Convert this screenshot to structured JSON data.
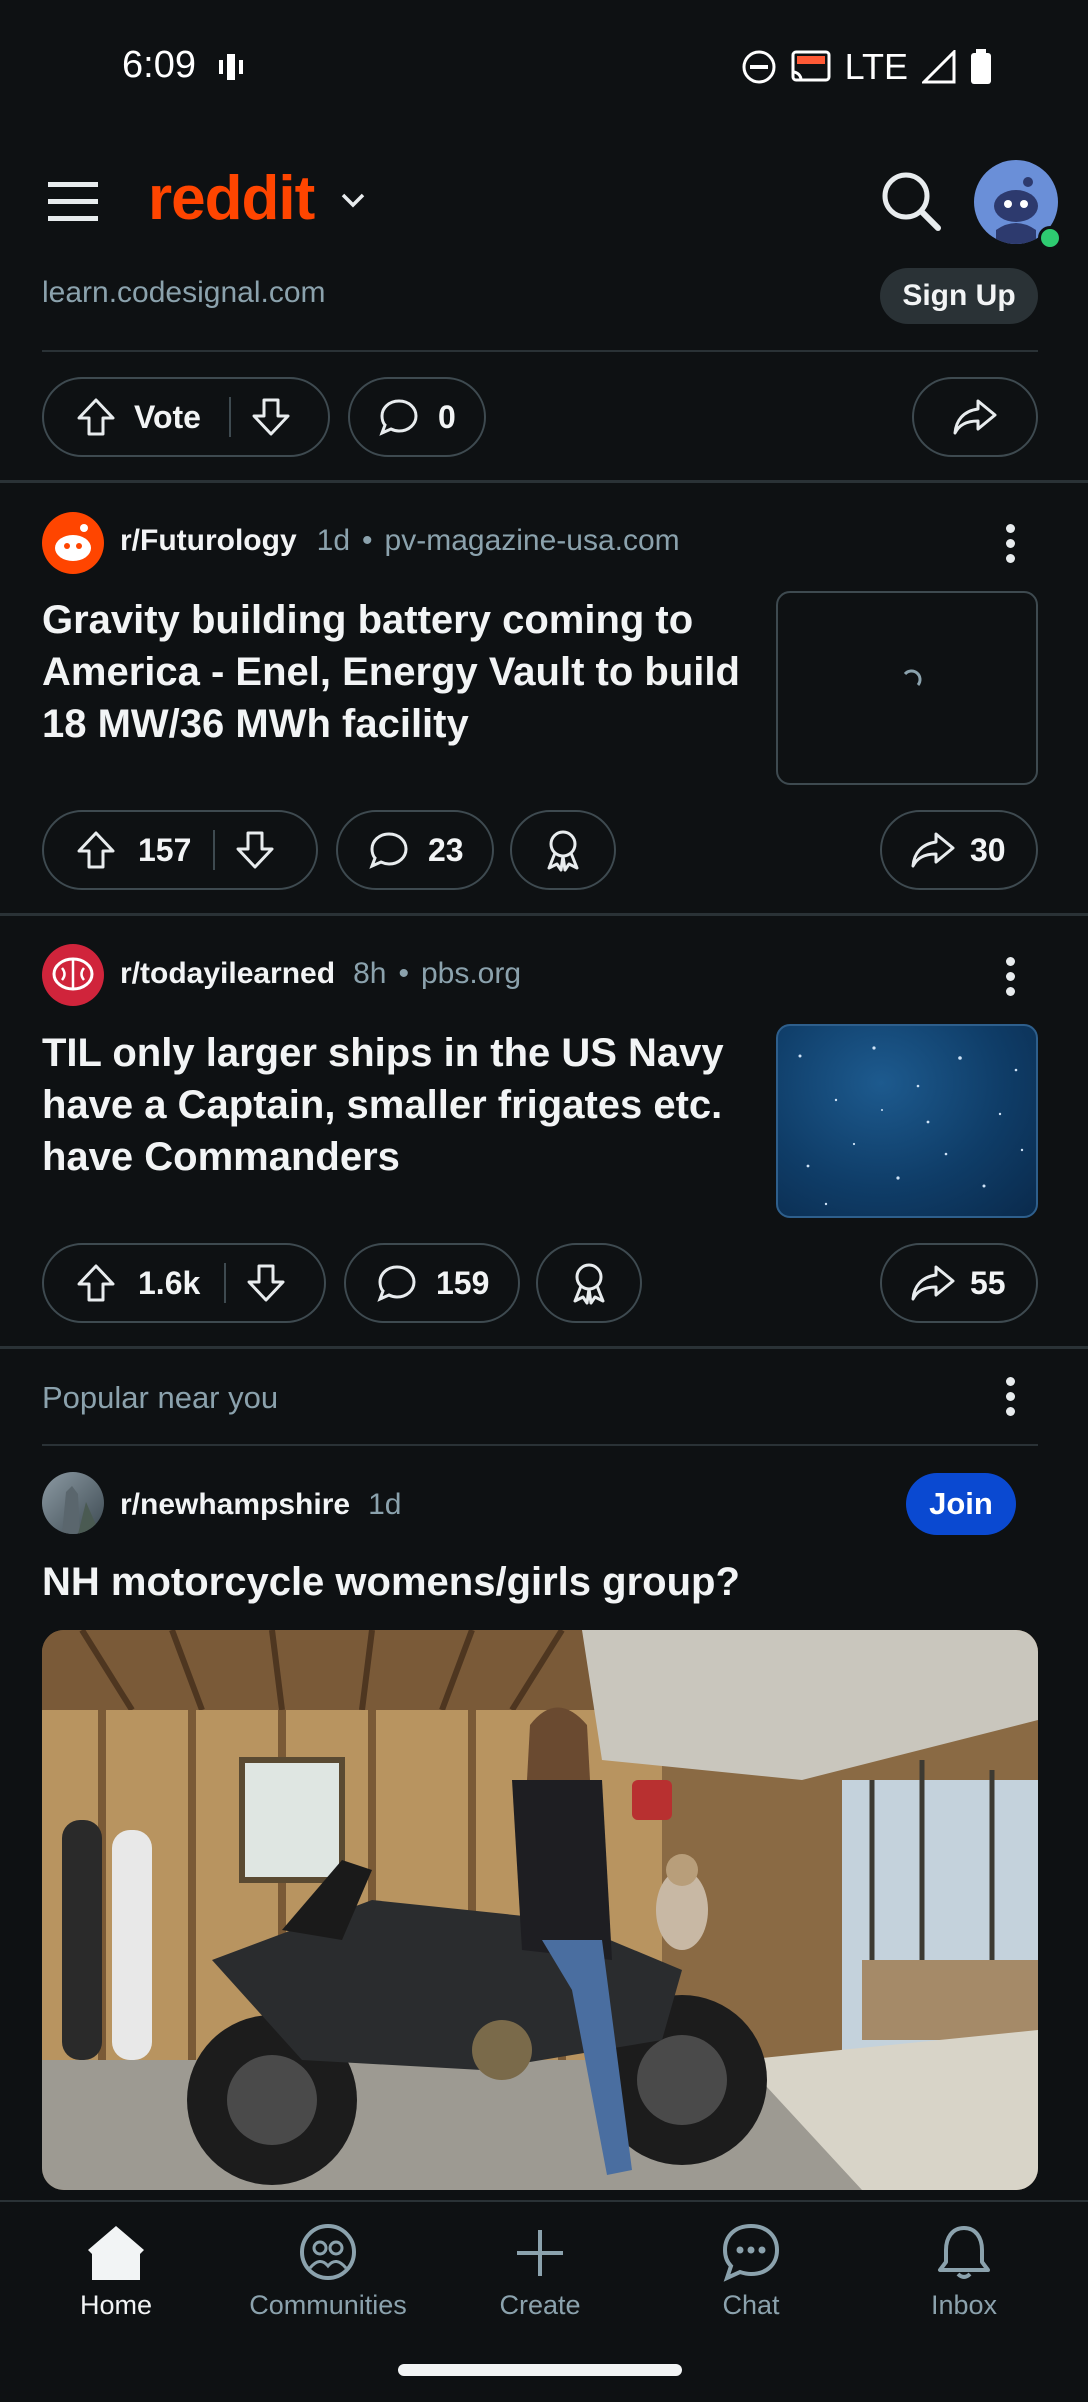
{
  "status_bar": {
    "time": "6:09",
    "network": "LTE"
  },
  "header": {
    "logo": "reddit"
  },
  "ad_fragment": {
    "domain": "learn.codesignal.com",
    "cta": "Sign Up",
    "vote_label": "Vote",
    "comments": "0"
  },
  "posts": [
    {
      "subreddit": "r/Futurology",
      "age": "1d",
      "domain": "pv-magazine-usa.com",
      "title": "Gravity building battery coming to America - Enel, Energy Vault to build 18 MW/36 MWh facility",
      "votes": "157",
      "comments": "23",
      "shares": "30"
    },
    {
      "subreddit": "r/todayilearned",
      "age": "8h",
      "domain": "pbs.org",
      "title": "TIL only larger ships in the US Navy have a Captain, smaller frigates etc. have Commanders",
      "votes": "1.6k",
      "comments": "159",
      "shares": "55"
    }
  ],
  "popular": {
    "heading": "Popular near you",
    "subreddit": "r/newhampshire",
    "age": "1d",
    "join_label": "Join",
    "title": "NH motorcycle womens/girls group?"
  },
  "nav": {
    "home": "Home",
    "communities": "Communities",
    "create": "Create",
    "chat": "Chat",
    "inbox": "Inbox"
  },
  "colors": {
    "brand": "#ff4500",
    "join": "#0a49d1",
    "online": "#2ecc71"
  }
}
